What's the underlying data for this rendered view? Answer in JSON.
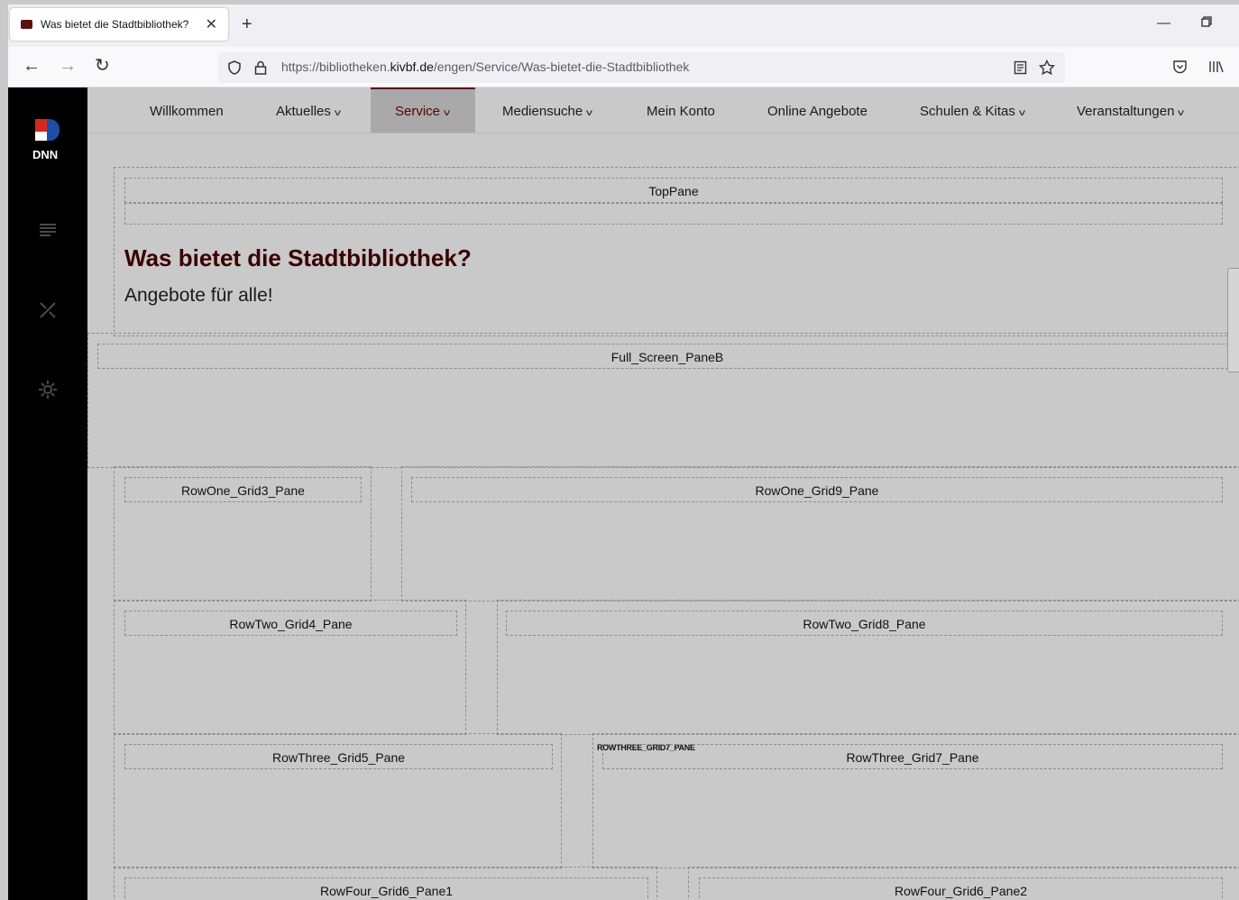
{
  "browser": {
    "tab_title": "Was bietet die Stadtbibliothek?",
    "url_prefix": "https://bibliotheken.",
    "url_domain": "kivbf.de",
    "url_path": "/engen/Service/Was-bietet-die-Stadtbibliothek"
  },
  "menu": {
    "items": [
      {
        "label": "Willkommen",
        "dropdown": false
      },
      {
        "label": "Aktuelles",
        "dropdown": true
      },
      {
        "label": "Service",
        "dropdown": true,
        "active": true
      },
      {
        "label": "Mediensuche",
        "dropdown": true
      },
      {
        "label": "Mein Konto",
        "dropdown": false
      },
      {
        "label": "Online Angebote",
        "dropdown": false
      },
      {
        "label": "Schulen & Kitas",
        "dropdown": true
      },
      {
        "label": "Veranstaltungen",
        "dropdown": true
      }
    ]
  },
  "content": {
    "heading": "Was bietet die Stadtbibliothek?",
    "subheading": "Angebote für alle!"
  },
  "panes": {
    "top": "TopPane",
    "full_screen_b": "Full_Screen_PaneB",
    "row_one_grid3": "RowOne_Grid3_Pane",
    "row_one_grid9": "RowOne_Grid9_Pane",
    "row_two_grid4": "RowTwo_Grid4_Pane",
    "row_two_grid8": "RowTwo_Grid8_Pane",
    "row_three_grid5": "RowThree_Grid5_Pane",
    "row_three_grid7": "RowThree_Grid7_Pane",
    "row_three_grid7_tag": "ROWTHREE_GRID7_PANE",
    "row_four_grid6_1": "RowFour_Grid6_Pane1",
    "row_four_grid6_2": "RowFour_Grid6_Pane2"
  },
  "colors": {
    "brand": "#5b1010",
    "page_bg": "#c9c9c9",
    "sidebar_bg": "#000000"
  }
}
